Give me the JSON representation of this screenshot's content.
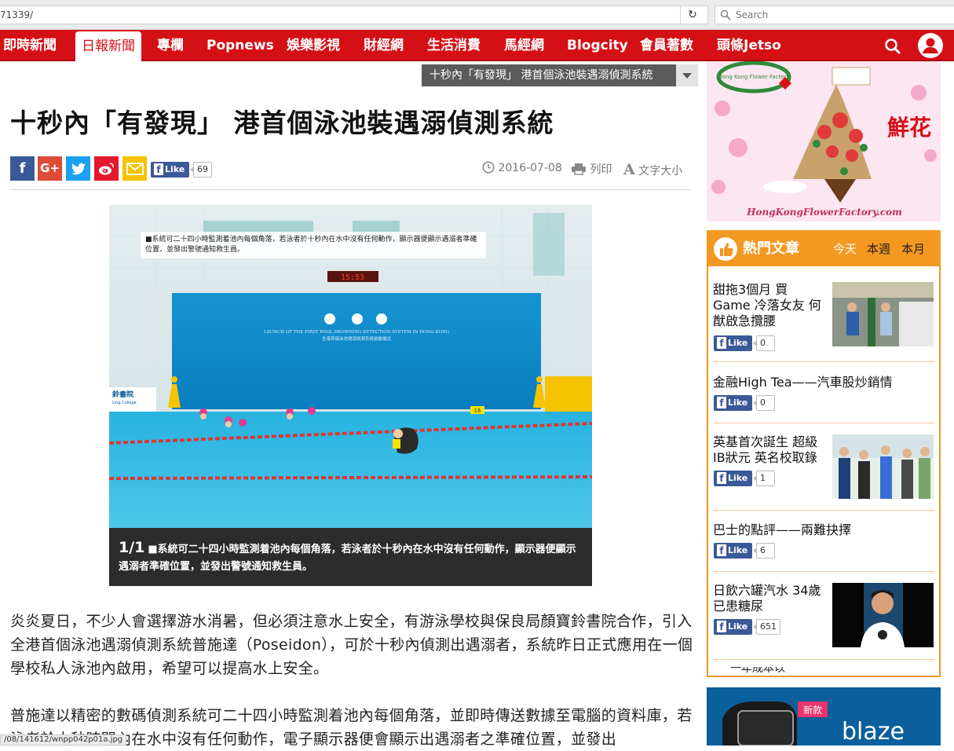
{
  "browser": {
    "url": "71339/",
    "search_placeholder": "Search"
  },
  "nav": {
    "items": [
      "即時新聞",
      "日報新聞",
      "專欄",
      "Popnews",
      "娛樂影視",
      "財經網",
      "生活消費",
      "馬經網",
      "Blogcity",
      "會員著數",
      "頭條Jetso"
    ],
    "active_index": 1,
    "brand_color": "#d50f16"
  },
  "breaking": {
    "text": "十秒內「有發現」 港首個泳池裝遇溺偵測系統"
  },
  "article": {
    "headline": "十秒內「有發現」 港首個泳池裝遇溺偵測系統",
    "like_label": "Like",
    "like_count": "69",
    "date": "2016-07-08",
    "print_label": "列印",
    "font_label": "文字大小",
    "photo": {
      "overlay_caption": "■系統可二十四小時監測着池內每個角落，若泳者於十秒內在水中沒有任何動作，顯示器便顯示遇溺者準確位置，並發出警號通知救生員。",
      "clock": "15:53",
      "banner_text": "LAUNCH OF THE FIRST POOL DROWNING DETECTION SYSTEM IN HONG KONG",
      "banner_sub": "全港首個泳池遇溺偵測系統啟動儀式",
      "college_sign": "鈴書院",
      "college_sub": "Ling College",
      "lane_marker": "16"
    },
    "caption_counter": "1/1",
    "caption": "■系統可二十四小時監測着池內每個角落，若泳者於十秒內在水中沒有任何動作，顯示器便顯示遇溺者準確位置，並發出警號通知救生員。",
    "paragraphs": [
      "炎炎夏日，不少人會選擇游水消暑，但必須注意水上安全，有游泳學校與保良局顏寶鈴書院合作，引入全港首個泳池遇溺偵測系統普施達（Poseidon），可於十秒內偵測出遇溺者，系統昨日正式應用在一個學校私人泳池內啟用，希望可以提高水上安全。",
      "普施達以精密的數碼偵測系統可二十四小時監測着池內每個角落，並即時傳送數據至電腦的資料庫，若泳者於十秒時間內在水中沒有任何動作，電子顯示器便會顯示出遇溺者之準確位置，並發出"
    ]
  },
  "status_url": "/08/141612/wnpp042p01a.jpg",
  "ad_flower": {
    "text": "鮮花",
    "site": "HongKongFlowerFactory.com",
    "logo": "Hong Kong Flower Factory"
  },
  "hot": {
    "title": "熱門文章",
    "tabs": [
      "今天",
      "本週",
      "本月"
    ],
    "active_tab": 0,
    "accent": "#f39821",
    "items": [
      {
        "title": "甜拖3個月 買Game 冷落女友 何猷啟急攬腰",
        "likes": "0",
        "thumb": "street"
      },
      {
        "title": "金融High Tea——汽車股炒銷情",
        "likes": "0",
        "thumb": ""
      },
      {
        "title": "英基首次誕生 超級IB狀元 英名校取錄",
        "likes": "1",
        "thumb": "students"
      },
      {
        "title": "巴士的點評——兩難抉擇",
        "likes": "6",
        "thumb": ""
      },
      {
        "title": "日飲六罐汽水 34歲已患糖尿",
        "likes": "651",
        "thumb": "portrait"
      }
    ],
    "like_label": "Like",
    "cut_off_text": "一年成本以"
  },
  "ad_blaze": {
    "badge": "新款",
    "brand": "blaze"
  }
}
